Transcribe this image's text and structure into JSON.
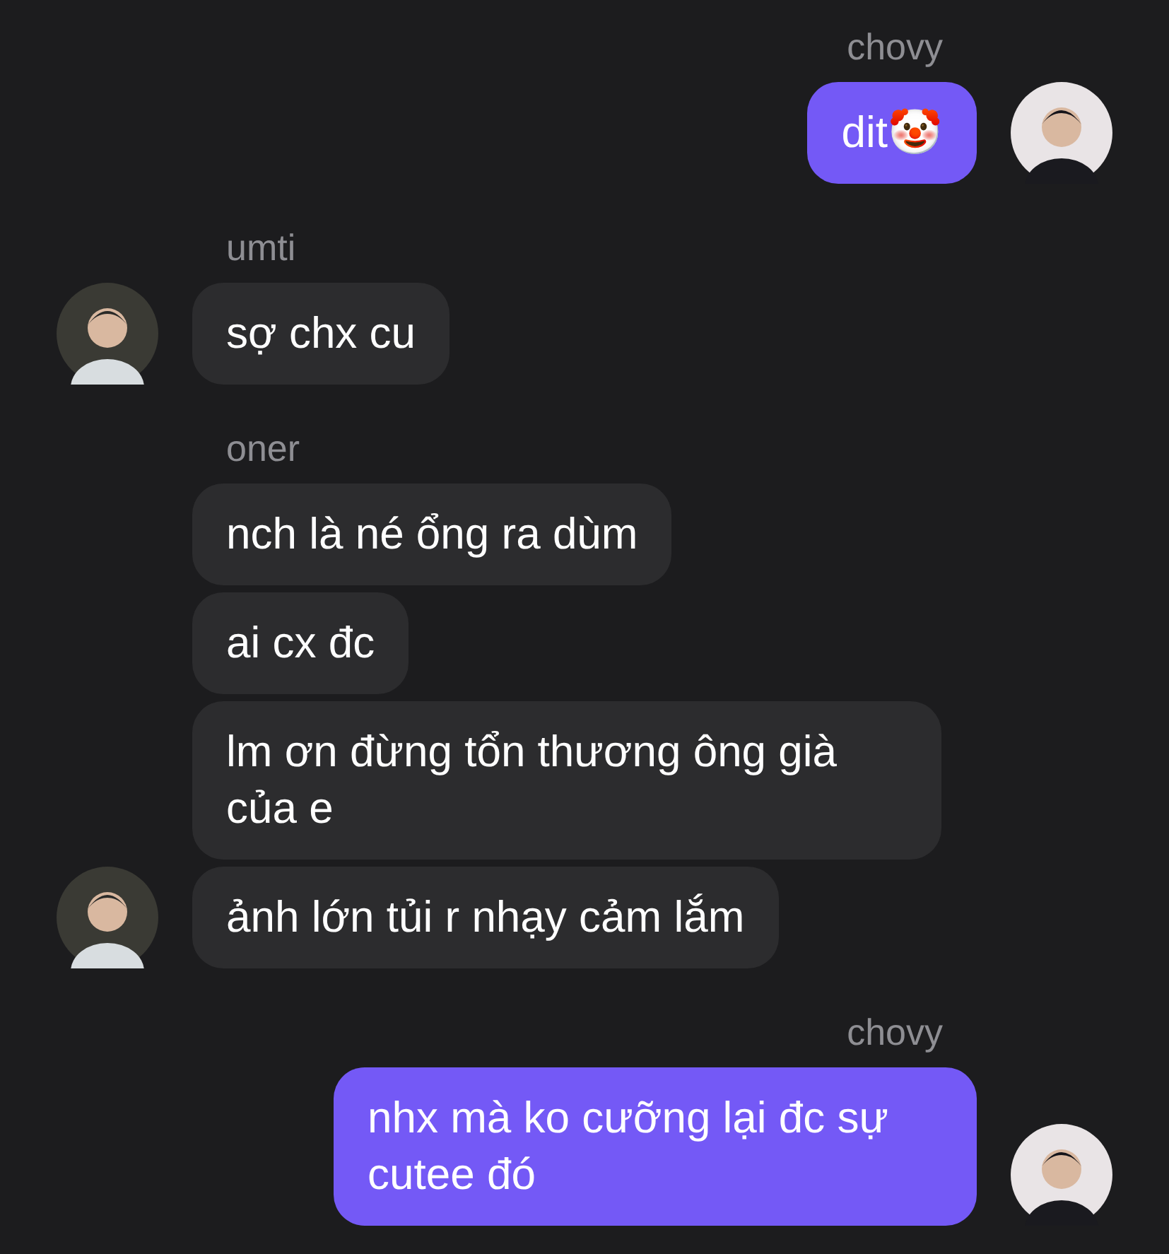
{
  "messages": [
    {
      "sender": "chovy",
      "outgoing": true,
      "bubbles": [
        "dit🤡"
      ]
    },
    {
      "sender": "umti",
      "outgoing": false,
      "bubbles": [
        "sợ chx cu"
      ]
    },
    {
      "sender": "oner",
      "outgoing": false,
      "bubbles": [
        "nch là né ổng ra dùm",
        "ai cx đc",
        "lm ơn đừng tổn thương ông già của e",
        "ảnh lớn tủi r nhạy cảm lắm"
      ]
    },
    {
      "sender": "chovy",
      "outgoing": true,
      "bubbles": [
        "nhx mà ko cưỡng lại đc sự cutee đó"
      ]
    }
  ]
}
